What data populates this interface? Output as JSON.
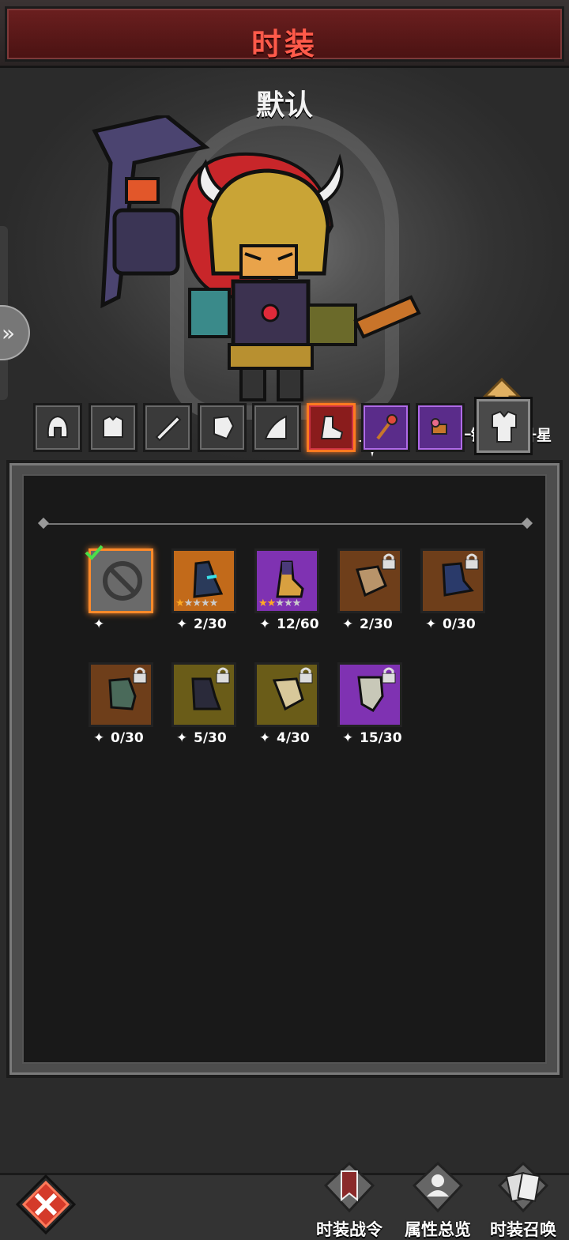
{
  "header": {
    "title": "时装"
  },
  "hero": {
    "skin_name": "默认"
  },
  "unlock": {
    "label": "一键解锁/升星"
  },
  "categories": [
    {
      "icon": "helmet-icon"
    },
    {
      "icon": "armor-icon"
    },
    {
      "icon": "weapon-icon"
    },
    {
      "icon": "gauntlet-icon"
    },
    {
      "icon": "cape-icon"
    },
    {
      "icon": "boots-icon",
      "active": true
    },
    {
      "icon": "staff-icon",
      "rarity": "purple"
    },
    {
      "icon": "pet-icon",
      "rarity": "purple"
    },
    {
      "icon": "outfit-icon"
    }
  ],
  "items": [
    {
      "color": "grey",
      "count": "",
      "equipped": true,
      "locked": false,
      "stars": 0
    },
    {
      "color": "orange",
      "count": "2/30",
      "locked": false,
      "stars": 1
    },
    {
      "color": "purple",
      "count": "12/60",
      "locked": false,
      "stars": 2
    },
    {
      "color": "brown",
      "count": "2/30",
      "locked": true,
      "stars": 0
    },
    {
      "color": "brown",
      "count": "0/30",
      "locked": true,
      "stars": 0
    },
    {
      "color": "brown",
      "count": "0/30",
      "locked": true,
      "stars": 0
    },
    {
      "color": "olive",
      "count": "5/30",
      "locked": true,
      "stars": 0
    },
    {
      "color": "olive",
      "count": "4/30",
      "locked": true,
      "stars": 0
    },
    {
      "color": "purple",
      "count": "15/30",
      "locked": true,
      "stars": 0
    }
  ],
  "bottom_nav": {
    "pass_label": "时装战令",
    "stats_label": "属性总览",
    "summon_label": "时装召唤"
  },
  "colors": {
    "accent": "#ff7a20",
    "title_red": "#ff5a4a"
  }
}
